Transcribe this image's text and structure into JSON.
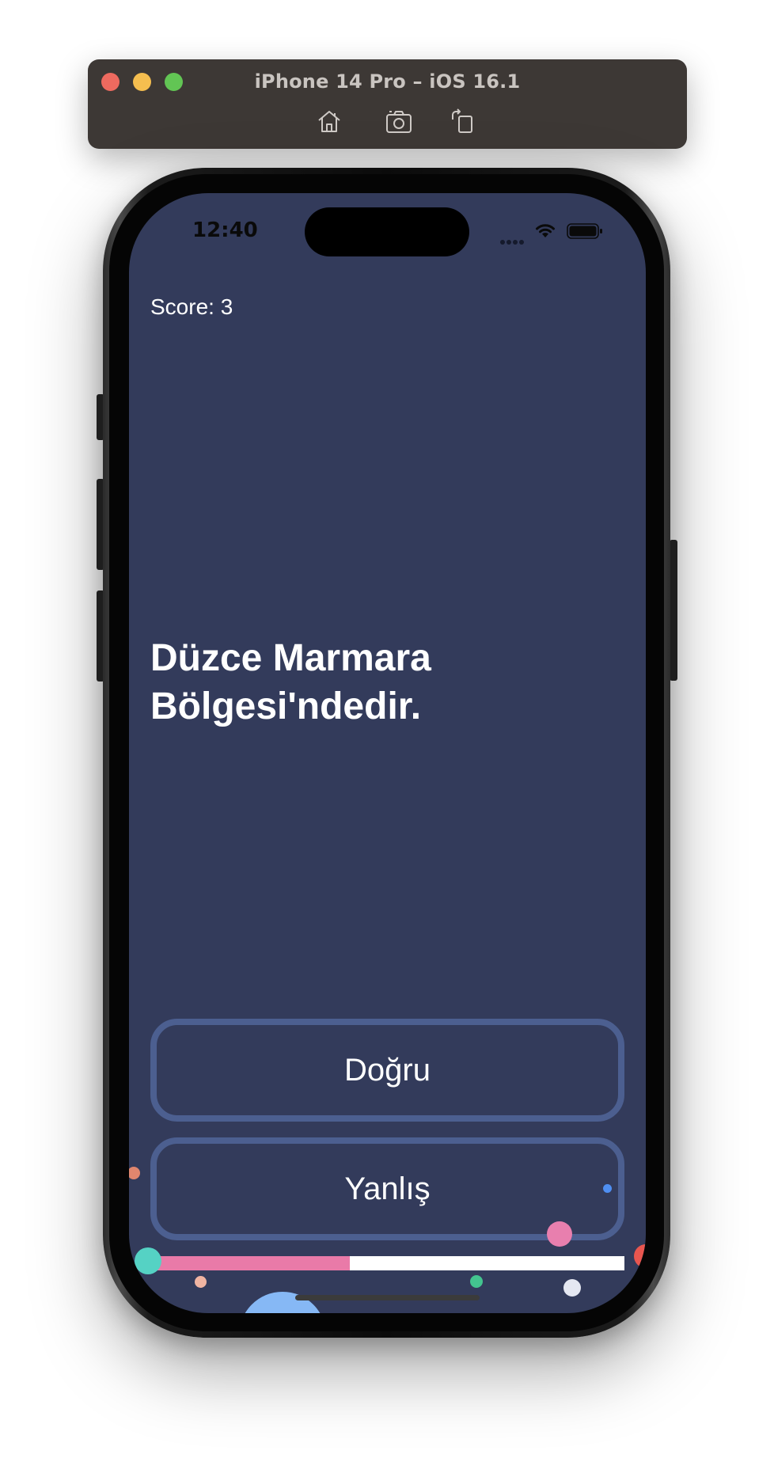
{
  "simulator": {
    "title": "iPhone 14 Pro – iOS 16.1",
    "toolbar": {
      "home_icon": "home-icon",
      "screenshot_icon": "camera-icon",
      "rotate_icon": "rotate-icon"
    }
  },
  "status_bar": {
    "time": "12:40",
    "signal_icon": "cellular-dots-icon",
    "wifi_icon": "wifi-icon",
    "battery_icon": "battery-icon"
  },
  "quiz": {
    "score_text": "Score: 3",
    "question": "Düzce Marmara Bölgesi'ndedir.",
    "answers": {
      "true_label": "Doğru",
      "false_label": "Yanlış"
    },
    "progress_fraction": 0.42
  },
  "colors": {
    "screen_background": "#333b5b",
    "button_border": "#4c5f90",
    "progress_fill": "#e97aa8",
    "progress_track": "#ffffff"
  }
}
